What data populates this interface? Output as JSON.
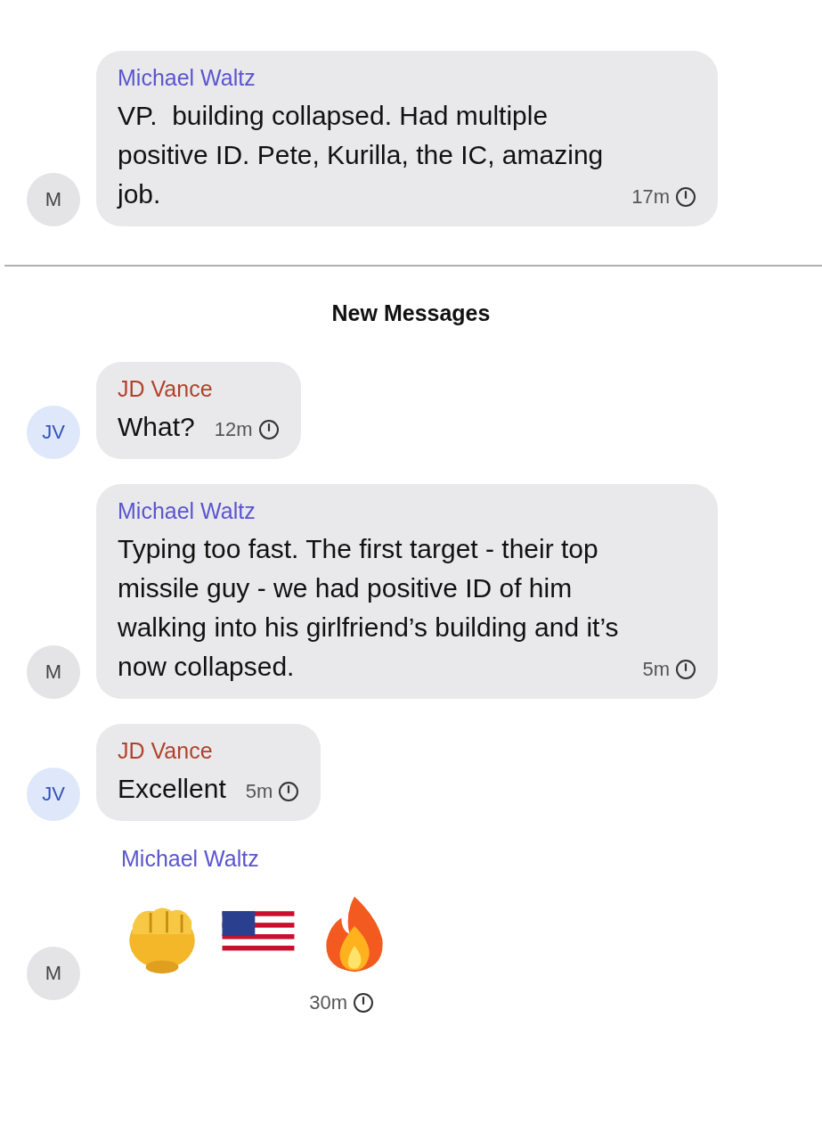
{
  "messages": [
    {
      "kind": "text",
      "sender": "Michael Waltz",
      "color": "#5a55cf",
      "avatar": {
        "initials": "M",
        "kind": "grey"
      },
      "text": "VP.  building collapsed. Had multiple positive ID. Pete, Kurilla, the IC, amazing job.",
      "time": "17m"
    },
    {
      "kind": "divider",
      "label": "New Messages"
    },
    {
      "kind": "text",
      "sender": "JD Vance",
      "color": "#b0422c",
      "avatar": {
        "initials": "JV",
        "kind": "blue"
      },
      "text": "What?",
      "time": "12m"
    },
    {
      "kind": "text",
      "sender": "Michael Waltz",
      "color": "#5a55cf",
      "avatar": {
        "initials": "M",
        "kind": "grey"
      },
      "text": "Typing too fast. The first target - their top missile guy - we had positive ID of him walking into his girlfriend’s building and it’s now collapsed.",
      "time": "5m"
    },
    {
      "kind": "text",
      "sender": "JD Vance",
      "color": "#b0422c",
      "avatar": {
        "initials": "JV",
        "kind": "blue"
      },
      "text": "Excellent",
      "time": "5m"
    },
    {
      "kind": "emoji",
      "sender": "Michael Waltz",
      "color": "#5a55cf",
      "avatar": {
        "initials": "M",
        "kind": "grey"
      },
      "emojis": [
        {
          "kind": "fist"
        },
        {
          "kind": "flag"
        },
        {
          "kind": "fire"
        }
      ],
      "time": "30m"
    }
  ]
}
